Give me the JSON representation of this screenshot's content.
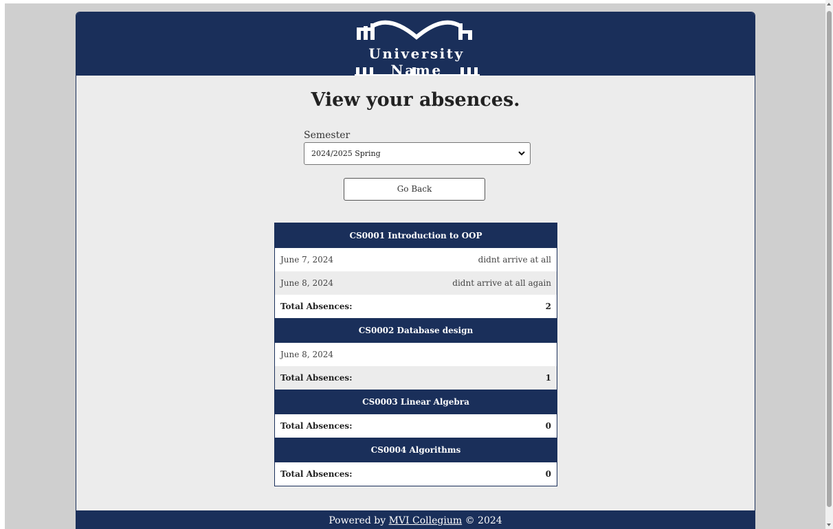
{
  "header": {
    "logo_text": "University Name"
  },
  "page": {
    "title": "View your absences."
  },
  "semester": {
    "label": "Semester",
    "selected": "2024/2025 Spring"
  },
  "go_back_label": "Go Back",
  "courses": [
    {
      "heading": "CS0001 Introduction to OOP",
      "absences": [
        {
          "date": "June 7, 2024",
          "note": "didnt arrive at all"
        },
        {
          "date": "June 8, 2024",
          "note": "didnt arrive at all again"
        }
      ],
      "total_label": "Total Absences:",
      "total": "2"
    },
    {
      "heading": "CS0002 Database design",
      "absences": [
        {
          "date": "June 8, 2024",
          "note": ""
        }
      ],
      "total_label": "Total Absences:",
      "total": "1"
    },
    {
      "heading": "CS0003 Linear Algebra",
      "absences": [],
      "total_label": "Total Absences:",
      "total": "0"
    },
    {
      "heading": "CS0004 Algorithms",
      "absences": [],
      "total_label": "Total Absences:",
      "total": "0"
    }
  ],
  "footer": {
    "prefix": "Powered by ",
    "link_text": "MVI Collegium",
    "suffix": " © 2024"
  },
  "colors": {
    "brand": "#1a2f5a",
    "page_bg": "#ececec",
    "outer_bg": "#cfcfcf"
  }
}
